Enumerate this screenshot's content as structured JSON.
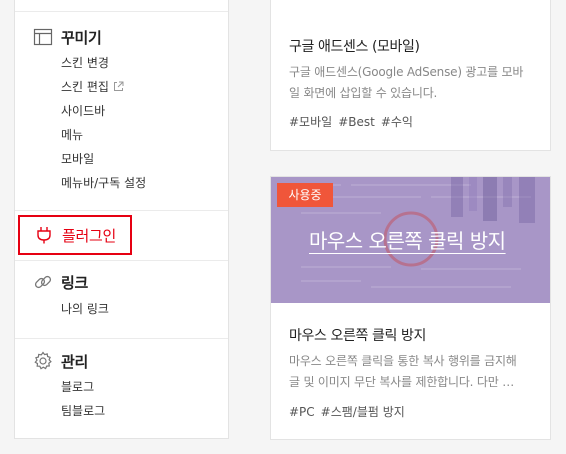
{
  "sidebar": {
    "decorate": {
      "title": "꾸미기",
      "items": [
        "스킨 변경",
        "스킨 편집",
        "사이드바",
        "메뉴",
        "모바일",
        "메뉴바/구독 설정"
      ]
    },
    "plugin": {
      "title": "플러그인"
    },
    "link": {
      "title": "링크",
      "items": [
        "나의 링크"
      ]
    },
    "manage": {
      "title": "관리",
      "items": [
        "블로그",
        "팀블로그"
      ]
    }
  },
  "cards": [
    {
      "title": "구글 애드센스 (모바일)",
      "desc_line1": "구글 애드센스(Google AdSense) 광고를 모바",
      "desc_line2": "일 화면에 삽입할 수 있습니다.",
      "tags": [
        "#모바일",
        "#Best",
        "#수익"
      ]
    },
    {
      "badge": "사용중",
      "thumb_title": "마우스 오른쪽 클릭 방지",
      "title": "마우스 오른쪽 클릭 방지",
      "desc_line1": "마우스 오른쪽 클릭을 통한 복사 행위를 금지해",
      "desc_line2": "글 및 이미지 무단 복사를 제한합니다. 다만 …",
      "tags": [
        "#PC",
        "#스팸/블펌 방지"
      ]
    }
  ],
  "colors": {
    "highlight": "#e60012",
    "badge": "#f0563a",
    "thumb": "#a896c7"
  },
  "icons": {
    "decorate": "layout-icon",
    "plugin": "plug-icon",
    "link": "link-icon",
    "manage": "gear-icon",
    "external": "external-link-icon"
  }
}
